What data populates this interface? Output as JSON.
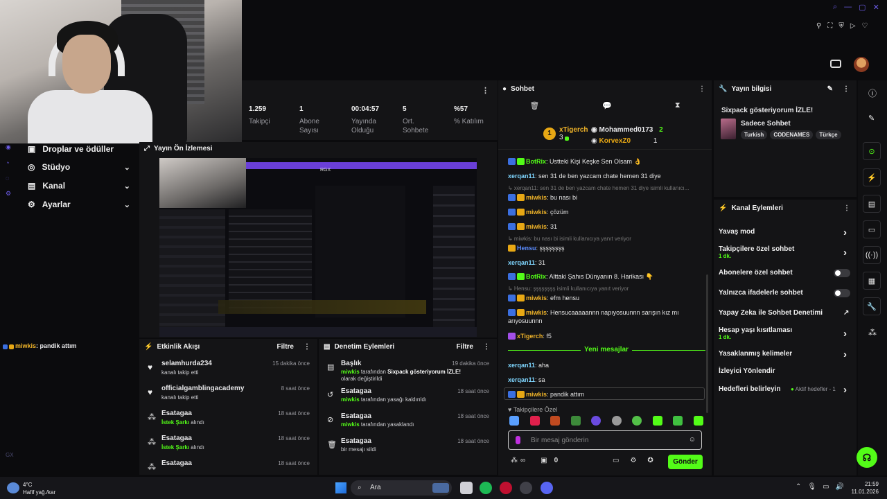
{
  "topbar": {
    "icons": [
      "search-icon",
      "minimize-icon",
      "maximize-icon",
      "close-icon",
      "pin-icon",
      "crop-icon",
      "shield-icon",
      "play-icon",
      "heart-icon"
    ]
  },
  "stats": {
    "items": [
      {
        "value": "1.259",
        "label": "Takipçi"
      },
      {
        "value": "1",
        "label": "Abone Sayısı"
      },
      {
        "value": "00:04:57",
        "label": "Yayında Olduğu"
      },
      {
        "value": "5",
        "label": "Ort. Sohbete"
      },
      {
        "value": "%57",
        "label": "% Katılım"
      }
    ]
  },
  "nav": {
    "items": [
      {
        "label": "Droplar ve ödüller",
        "icon": "gift-icon"
      },
      {
        "label": "Stüdyo",
        "icon": "studio-icon"
      },
      {
        "label": "Kanal",
        "icon": "channel-icon"
      },
      {
        "label": "Ayarlar",
        "icon": "gear-icon"
      }
    ]
  },
  "overlay_chat": {
    "user": "miwkis",
    "text": ": pandik attım"
  },
  "preview": {
    "title": "Yayın Ön İzlemesi",
    "tag": "RGX"
  },
  "activity": {
    "title": "Etkinlik Akışı",
    "filter": "Filtre",
    "items": [
      {
        "name": "selamhurda234",
        "sub": "kanalı takip etti",
        "time": "15 dakika önce",
        "icon": "heart-icon",
        "sub_green": false
      },
      {
        "name": "officialgamblingacademy",
        "sub": "kanalı takip etti",
        "time": "8 saat önce",
        "icon": "heart-icon",
        "sub_green": false
      },
      {
        "name": "Esatagaa",
        "sub": "İstek Şarkı",
        "sub2": " alındı",
        "time": "18 saat önce",
        "icon": "kick-icon",
        "sub_green": true
      },
      {
        "name": "Esatagaa",
        "sub": "İstek Şarkı",
        "sub2": " alındı",
        "time": "18 saat önce",
        "icon": "kick-icon",
        "sub_green": true
      },
      {
        "name": "Esatagaa",
        "sub": "",
        "time": "18 saat önce",
        "icon": "kick-icon",
        "sub_green": false
      }
    ]
  },
  "moderation": {
    "title": "Denetim Eylemleri",
    "filter": "Filtre",
    "items": [
      {
        "name": "Başlık",
        "time": "19 dakika önce",
        "who": "miwkis",
        "text": " tarafından ",
        "bold": "Sixpack gösteriyorum İZLE!",
        "text2": " olarak değiştirildi"
      },
      {
        "name": "Esatagaa",
        "time": "18 saat önce",
        "who": "miwkis",
        "text": " tarafından yasağı kaldırıldı"
      },
      {
        "name": "Esatagaa",
        "time": "18 saat önce",
        "who": "miwkis",
        "text": " tarafından yasaklandı"
      },
      {
        "name": "Esatagaa",
        "time": "18 saat önce",
        "who": "",
        "text": "bir mesajı sildi"
      }
    ]
  },
  "chat": {
    "title": "Sohbet",
    "pinned": [
      {
        "name": "xTigerch",
        "count": "3",
        "rank": "1"
      },
      {
        "name": "Mohammed0173",
        "count": "2"
      },
      {
        "name": "KorvexZ0",
        "count": "1"
      }
    ],
    "messages": [
      {
        "user": "BotRix",
        "text": ": Ustteki Kişi Keşke Sen Olsam 👌",
        "color": "u-green",
        "badges": [
          "b-blue",
          "b-green"
        ]
      },
      {
        "user": "xerqan11",
        "text": ": sen 31 de ben yazcam chate hemen 31 diye",
        "color": "u-cyan",
        "badges": []
      },
      {
        "reply": "↳ xerqan11: sen 31 de ben yazcam chate hemen 31 diye isimli kullanıcı..."
      },
      {
        "user": "miwkis",
        "text": ": bu nası bi",
        "color": "u-gold",
        "badges": [
          "b-blue",
          "b-gold"
        ]
      },
      {
        "user": "miwkis",
        "text": ": çözüm",
        "color": "u-gold",
        "badges": [
          "b-blue",
          "b-gold"
        ]
      },
      {
        "user": "miwkis",
        "text": ": 31",
        "color": "u-gold",
        "badges": [
          "b-blue",
          "b-gold"
        ]
      },
      {
        "reply": "↳ miwkis: bu nası bi isimli kullanıcıya yanıt veriyor"
      },
      {
        "user": "Hensu",
        "text": ": şşşşşşşş",
        "color": "u-blue",
        "badges": [
          "b-gold"
        ]
      },
      {
        "user": "xerqan11",
        "text": ": 31",
        "color": "u-cyan",
        "badges": []
      },
      {
        "user": "BotRix",
        "text": ": Alttaki Şahıs Dünyanın 8. Harikası 👇",
        "color": "u-green",
        "badges": [
          "b-blue",
          "b-green"
        ]
      },
      {
        "reply": "↳ Hensu: şşşşşşşş isimli kullanıcıya yanıt veriyor"
      },
      {
        "user": "miwkis",
        "text": ": efm hensu",
        "color": "u-gold",
        "badges": [
          "b-blue",
          "b-gold"
        ]
      },
      {
        "user": "miwkis",
        "text": ": Hensucaaaaannn napıyosuunnn sarışın kız mı arıyosuunnn",
        "color": "u-gold",
        "badges": [
          "b-blue",
          "b-gold"
        ]
      },
      {
        "user": "xTigerch",
        "text": ": f5",
        "color": "u-gold",
        "badges": [
          "b-purple"
        ]
      }
    ],
    "new_messages_label": "Yeni mesajlar",
    "new_messages": [
      {
        "user": "xerqan11",
        "text": ": aha",
        "color": "u-cyan",
        "badges": []
      },
      {
        "user": "xerqan11",
        "text": ": sa",
        "color": "u-cyan",
        "badges": []
      },
      {
        "user": "miwkis",
        "text": ": pandik attım",
        "color": "u-gold",
        "badges": [
          "b-blue",
          "b-gold"
        ]
      }
    ],
    "followers_only": "Takipçilere Özel",
    "input_placeholder": "Bir mesaj gönderin",
    "send_label": "Gönder",
    "coins": "0"
  },
  "stream_info": {
    "title": "Yayın bilgisi",
    "stream_title": "Sixpack gösteriyorum İZLE!",
    "category": "Sadece Sohbet",
    "tags": [
      "Turkish",
      "CODENAMES",
      "Türkçe"
    ]
  },
  "channel_actions": {
    "title": "Kanal Eylemleri",
    "items": [
      {
        "label": "Yavaş mod",
        "sub": "",
        "control": "chevron"
      },
      {
        "label": "Takipçilere özel sohbet",
        "sub": "1 dk.",
        "control": "chevron"
      },
      {
        "label": "Abonelere özel sohbet",
        "sub": "",
        "control": "toggle"
      },
      {
        "label": "Yalnızca ifadelerle sohbet",
        "sub": "",
        "control": "toggle"
      },
      {
        "label": "Yapay Zeka ile Sohbet Denetimi",
        "sub": "",
        "control": "external"
      },
      {
        "label": "Hesap yaşı kısıtlaması",
        "sub": "1 dk.",
        "control": "chevron"
      },
      {
        "label": "Yasaklanmış kelimeler",
        "sub": "",
        "control": "chevron"
      },
      {
        "label": "İzleyici Yönlendir",
        "sub": "",
        "control": "none"
      },
      {
        "label": "Hedefleri belirleyin",
        "sub": "",
        "control": "chevron",
        "note": "Aktif hedefler - 1"
      }
    ]
  },
  "taskbar": {
    "weather_temp": "4°C",
    "weather_desc": "Hafif yağ./kar",
    "search_label": "Ara",
    "time": "21:59",
    "date": "11.01.2026"
  },
  "colors": {
    "accent": "#53fc18",
    "panel": "#141416",
    "bg": "#0b0b0d"
  }
}
